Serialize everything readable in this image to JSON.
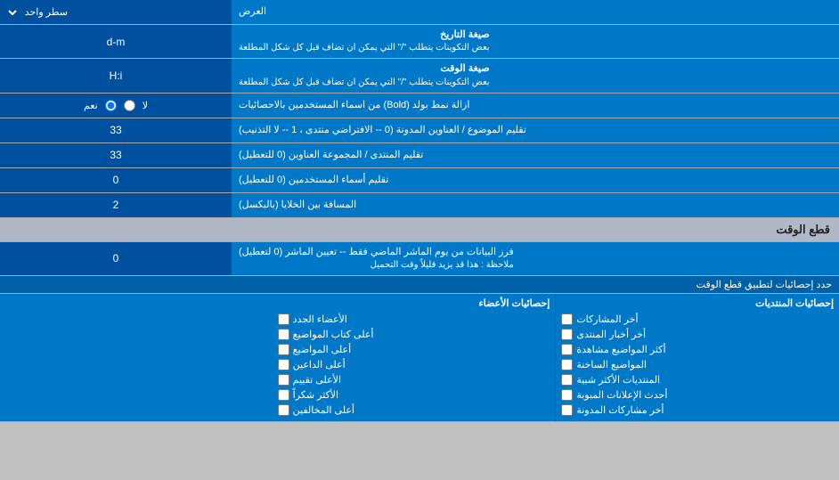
{
  "page": {
    "top_label": "العرض",
    "single_line_label": "سطر واحد",
    "date_format": {
      "label": "صيغة التاريخ",
      "sublabel": "بعض التكوينات يتطلب \"/\" التي يمكن ان تضاف قبل كل شكل المطلعة",
      "value": "d-m"
    },
    "time_format": {
      "label": "صيغة الوقت",
      "sublabel": "بعض التكوينات يتطلب \"/\" التي يمكن ان تضاف قبل كل شكل المطلعة",
      "value": "H:i"
    },
    "bold_label": "ازالة نمط بولد (Bold) من اسماء المستخدمين بالاحصائيات",
    "bold_option_yes": "نعم",
    "bold_option_no": "لا",
    "topics_label": "تقليم الموضوع / العناوين المدونة (0 -- الافتراضي منتدى ، 1 -- لا التذنيب)",
    "topics_value": "33",
    "forum_label": "تقليم المنتدى / المجموعة العناوين (0 للتعطيل)",
    "forum_value": "33",
    "users_label": "تقليم أسماء المستخدمين (0 للتعطيل)",
    "users_value": "0",
    "spacing_label": "المسافة بين الخلايا (بالبكسل)",
    "spacing_value": "2",
    "cutoff_section": "قطع الوقت",
    "cutoff_label": "فرز البيانات من يوم الماشر الماضي فقط -- تعيين الماشر (0 لتعطيل)",
    "cutoff_sublabel": "ملاحظة : هذا قد يزيد قليلاً وقت التحميل",
    "cutoff_value": "0",
    "stats_cutoff_label": "حدد إحصائيات لتطبيق قطع الوقت",
    "checkboxes": {
      "col1_title": "إحصائيات المنتديات",
      "col1_items": [
        "أخر المشاركات",
        "أخر أخبار المنتدى",
        "أكثر المواضيع مشاهدة",
        "المواضيع الساخنة",
        "المنتديات الأكثر شبية",
        "أحدث الإعلانات المبوبة",
        "أخر مشاركات المدونة"
      ],
      "col2_title": "إحصائيات الأعضاء",
      "col2_items": [
        "الأعضاء الجدد",
        "أعلى كتاب المواضيع",
        "أعلى المواضيع",
        "أعلى الداعين",
        "الأعلى تقييم",
        "الأكثر شكراً",
        "أعلى المخالفين"
      ]
    }
  }
}
